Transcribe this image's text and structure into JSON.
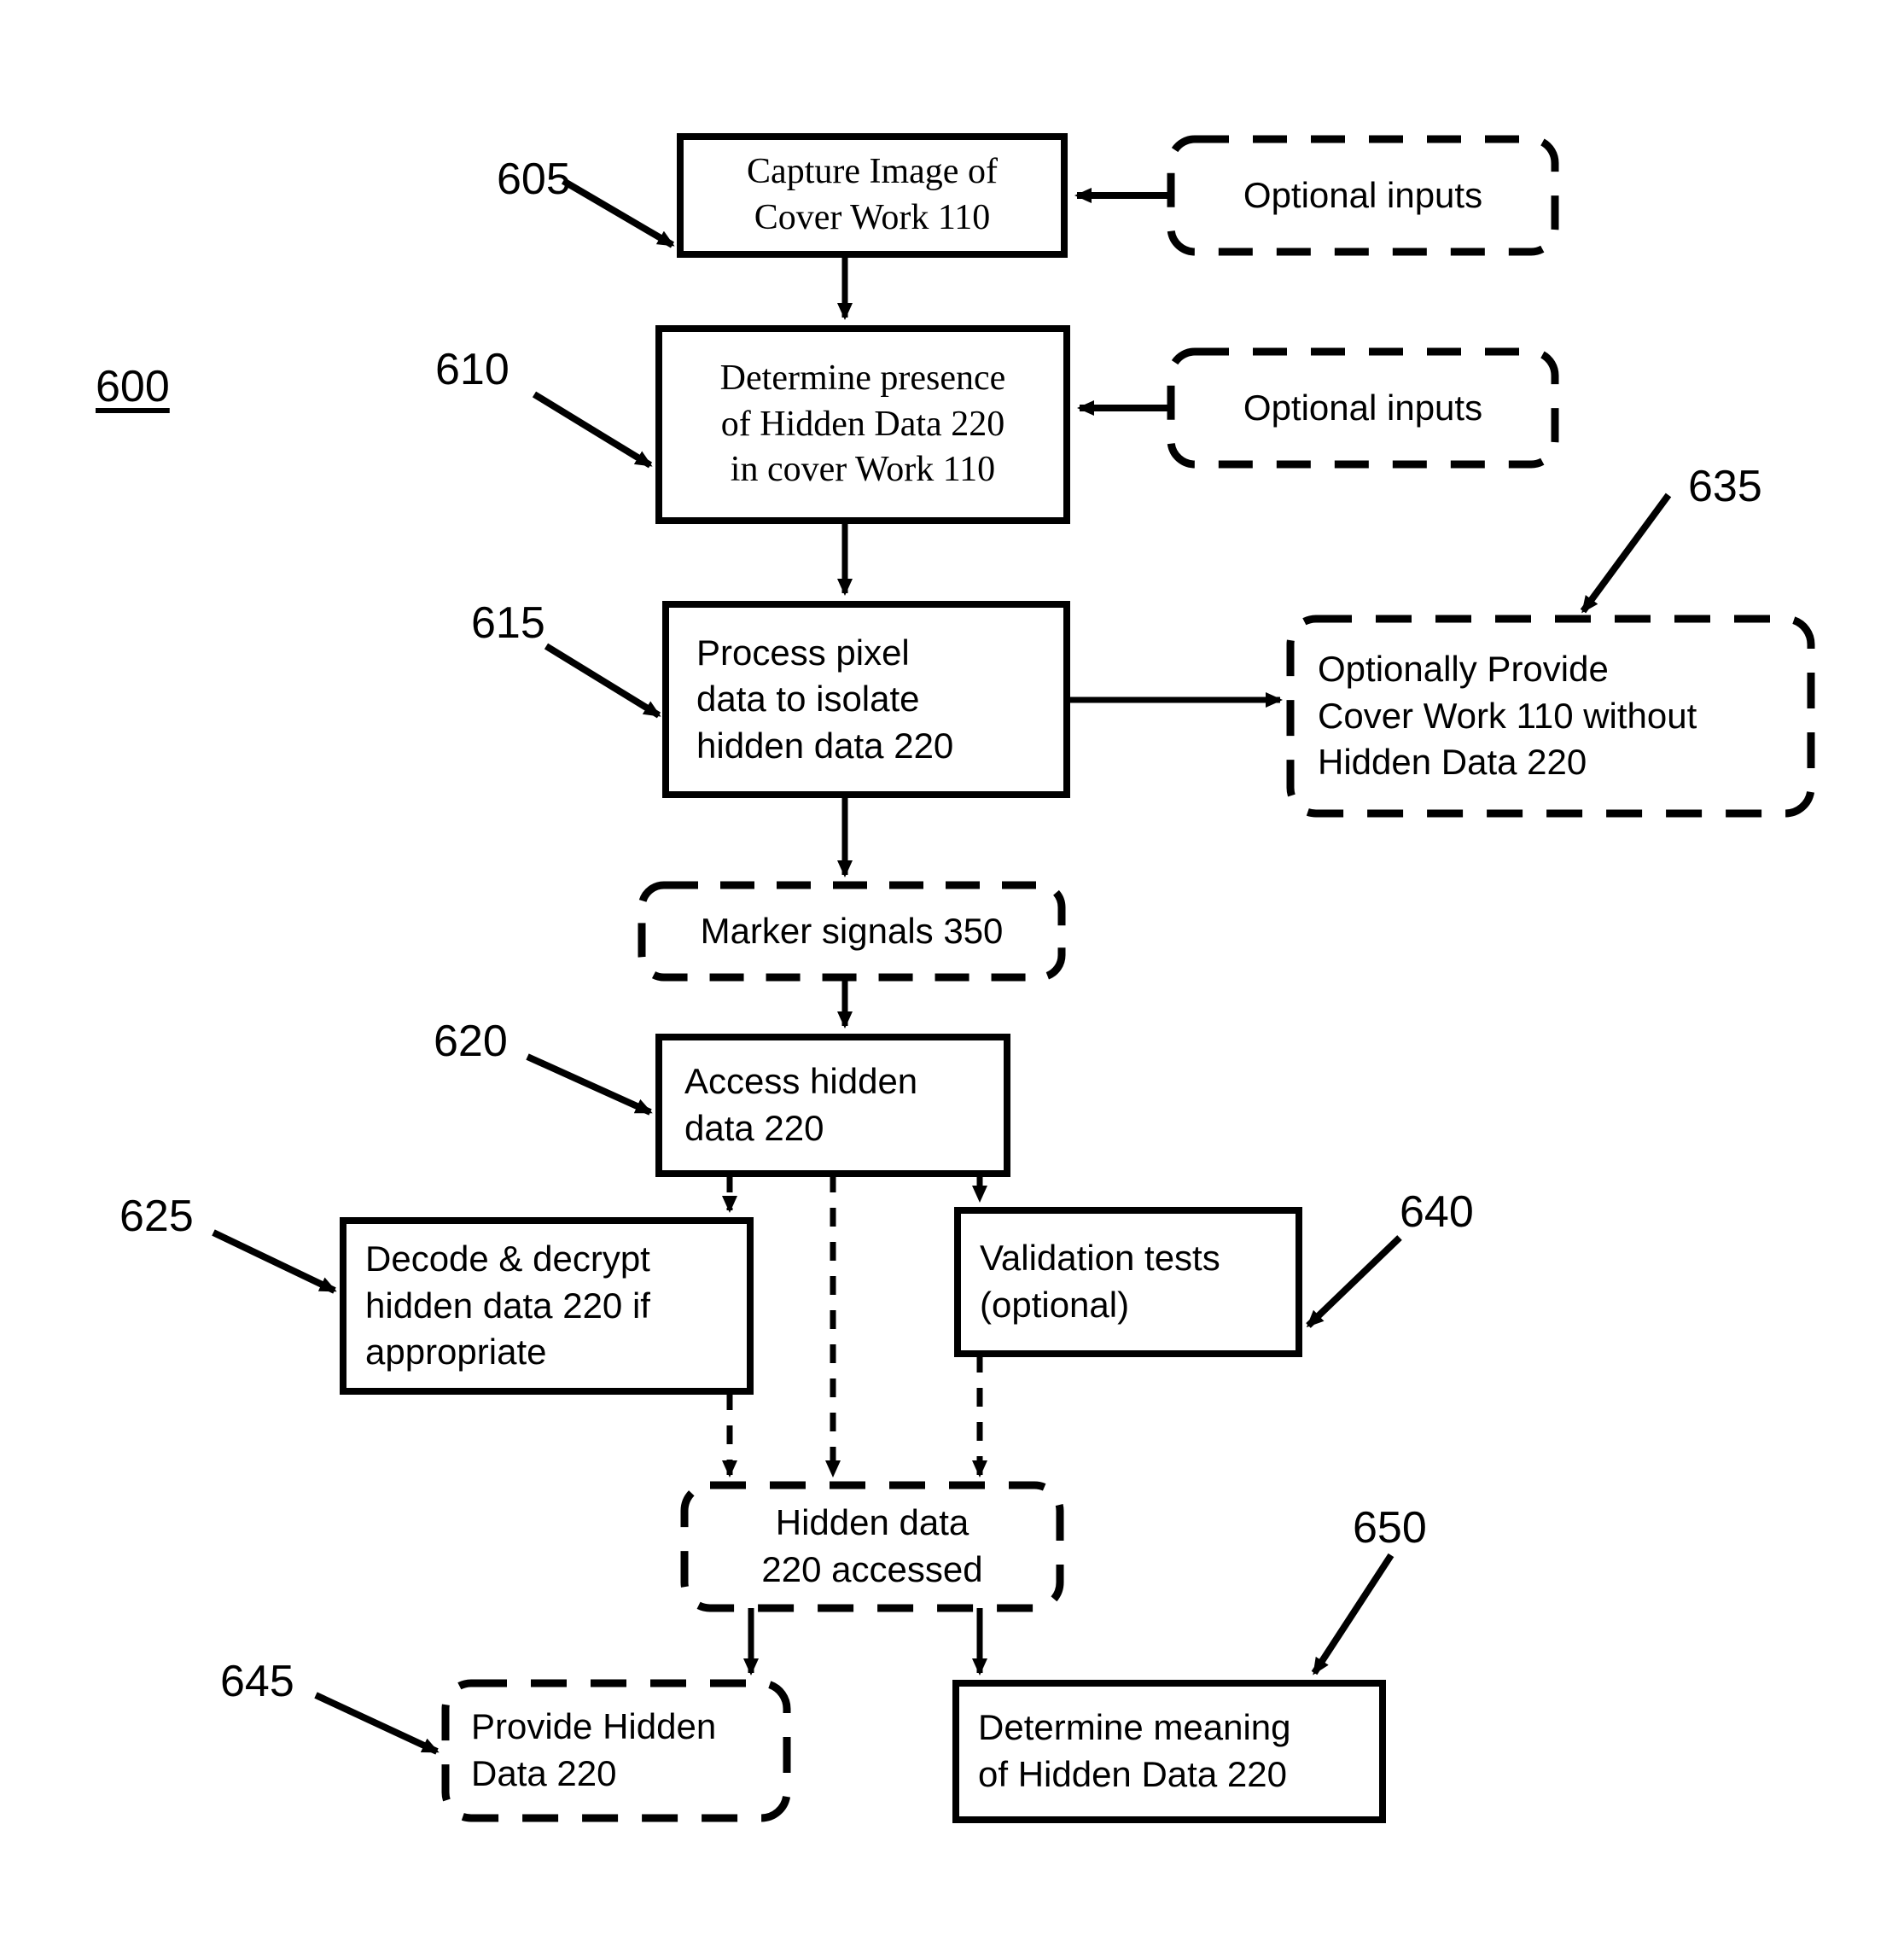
{
  "figure": {
    "figure_number": "600",
    "boxes": [
      {
        "id": "capture-image",
        "ref": "605",
        "style": "solid",
        "font": "serif",
        "lines": [
          "Capture Image of",
          "Cover Work 110"
        ]
      },
      {
        "id": "optional-inputs-1",
        "ref": "",
        "style": "dashed",
        "font": "sans",
        "lines": [
          "Optional inputs"
        ]
      },
      {
        "id": "determine-presence",
        "ref": "610",
        "style": "solid",
        "font": "serif",
        "lines": [
          "Determine presence",
          "of Hidden Data 220",
          "in cover Work 110"
        ]
      },
      {
        "id": "optional-inputs-2",
        "ref": "",
        "style": "dashed",
        "font": "sans",
        "lines": [
          "Optional inputs"
        ]
      },
      {
        "id": "process-pixel-data",
        "ref": "615",
        "style": "solid",
        "font": "sans",
        "lines": [
          "Process pixel",
          "data to isolate",
          "hidden data 220"
        ]
      },
      {
        "id": "optionally-provide-cover-work",
        "ref": "635",
        "style": "dashed",
        "font": "sans",
        "lines": [
          "Optionally Provide",
          "Cover Work 110 without",
          "Hidden Data 220"
        ]
      },
      {
        "id": "marker-signals",
        "ref": "",
        "style": "dashed",
        "font": "sans",
        "lines": [
          "Marker signals 350"
        ]
      },
      {
        "id": "access-hidden-data",
        "ref": "620",
        "style": "solid",
        "font": "sans",
        "lines": [
          "Access hidden",
          "data 220"
        ]
      },
      {
        "id": "decode-decrypt",
        "ref": "625",
        "style": "solid",
        "font": "sans",
        "lines": [
          "Decode & decrypt",
          "hidden data 220 if",
          "appropriate"
        ]
      },
      {
        "id": "validation-tests",
        "ref": "640",
        "style": "solid",
        "font": "sans",
        "lines": [
          "Validation tests",
          "(optional)"
        ]
      },
      {
        "id": "hidden-data-accessed",
        "ref": "",
        "style": "dashed",
        "font": "sans",
        "lines": [
          "Hidden data",
          "220 accessed"
        ]
      },
      {
        "id": "provide-hidden-data",
        "ref": "645",
        "style": "dashed",
        "font": "sans",
        "lines": [
          "Provide Hidden",
          "Data 220"
        ]
      },
      {
        "id": "determine-meaning",
        "ref": "650",
        "style": "solid",
        "font": "sans",
        "lines": [
          "Determine meaning",
          "of Hidden Data 220"
        ]
      }
    ],
    "reference_numerals": [
      "600",
      "605",
      "610",
      "615",
      "620",
      "625",
      "635",
      "640",
      "645",
      "650"
    ],
    "text": {
      "fig_600": "600",
      "ref_605": "605",
      "ref_610": "610",
      "ref_615": "615",
      "ref_620": "620",
      "ref_625": "625",
      "ref_635": "635",
      "ref_640": "640",
      "ref_645": "645",
      "ref_650": "650",
      "capture_l1": "Capture Image of",
      "capture_l2": "Cover Work 110",
      "optional_inputs_1": "Optional inputs",
      "determine_l1": "Determine presence",
      "determine_l2": "of Hidden Data 220",
      "determine_l3": "in cover Work 110",
      "optional_inputs_2": "Optional inputs",
      "process_l1": "Process pixel",
      "process_l2": "data to isolate",
      "process_l3": "hidden data 220",
      "optprov_l1": "Optionally Provide",
      "optprov_l2": "Cover Work 110 without",
      "optprov_l3": "Hidden Data 220",
      "marker_l1": "Marker signals 350",
      "access_l1": "Access hidden",
      "access_l2": "data 220",
      "decode_l1": "Decode & decrypt",
      "decode_l2": "hidden data 220 if",
      "decode_l3": "appropriate",
      "validation_l1": "Validation tests",
      "validation_l2": "(optional)",
      "accessed_l1": "Hidden data",
      "accessed_l2": "220 accessed",
      "provide_l1": "Provide Hidden",
      "provide_l2": "Data 220",
      "meaning_l1": "Determine meaning",
      "meaning_l2": "of Hidden Data 220"
    },
    "colors": {
      "stroke": "#000000",
      "background": "#ffffff"
    }
  }
}
